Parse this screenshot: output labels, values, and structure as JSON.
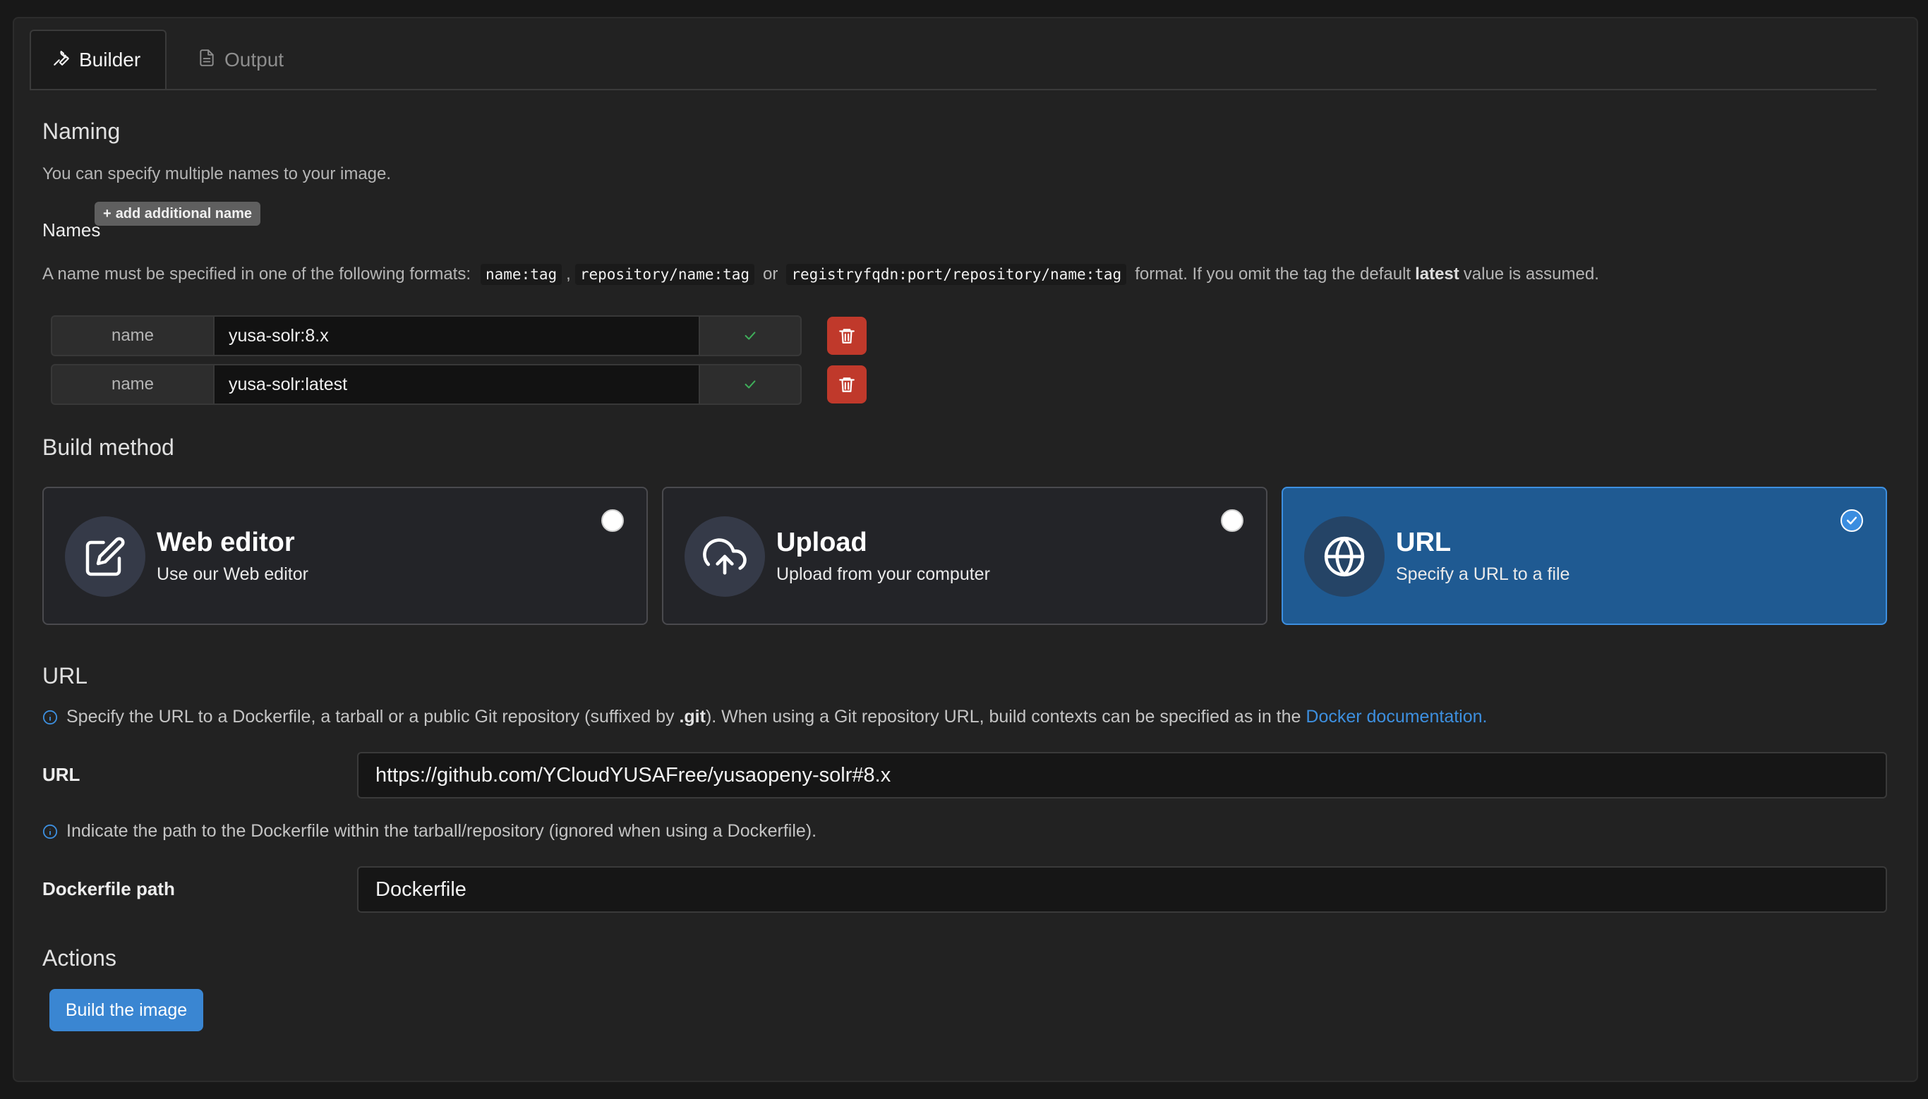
{
  "tabs": [
    {
      "label": "Builder",
      "icon": "wrench-icon",
      "active": true
    },
    {
      "label": "Output",
      "icon": "document-icon",
      "active": false
    }
  ],
  "naming": {
    "title": "Naming",
    "description": "You can specify multiple names to your image.",
    "names_label": "Names",
    "add_name_label": "add additional name",
    "format_intro": "A name must be specified in one of the following formats:",
    "format_1": "name:tag",
    "format_sep_1": ",",
    "format_2": "repository/name:tag",
    "format_sep_2": "or",
    "format_3": "registryfqdn:port/repository/name:tag",
    "format_outro_1": "format. If you omit the tag the default",
    "format_bold": "latest",
    "format_outro_2": "value is assumed.",
    "rows": [
      {
        "label": "name",
        "value": "yusa-solr:8.x"
      },
      {
        "label": "name",
        "value": "yusa-solr:latest"
      }
    ]
  },
  "build_method": {
    "title": "Build method",
    "options": [
      {
        "title": "Web editor",
        "subtitle": "Use our Web editor",
        "icon": "edit-icon",
        "selected": false
      },
      {
        "title": "Upload",
        "subtitle": "Upload from your computer",
        "icon": "upload-cloud-icon",
        "selected": false
      },
      {
        "title": "URL",
        "subtitle": "Specify a URL to a file",
        "icon": "globe-icon",
        "selected": true
      }
    ]
  },
  "url_section": {
    "title": "URL",
    "info_1": "Specify the URL to a Dockerfile, a tarball or a public Git repository (suffixed by",
    "info_1_bold": ".git",
    "info_1_rest": "). When using a Git repository URL, build contexts can be specified as in the",
    "info_1_link": "Docker documentation.",
    "url_label": "URL",
    "url_value": "https://github.com/YCloudYUSAFree/yusaopeny-solr#8.x",
    "info_2": "Indicate the path to the Dockerfile within the tarball/repository (ignored when using a Dockerfile).",
    "path_label": "Dockerfile path",
    "path_value": "Dockerfile"
  },
  "actions": {
    "title": "Actions",
    "build_label": "Build the image"
  },
  "colors": {
    "accent": "#3a86d2",
    "selected_card": "#1f5a92",
    "danger": "#c0392b",
    "success": "#3fae5a"
  }
}
